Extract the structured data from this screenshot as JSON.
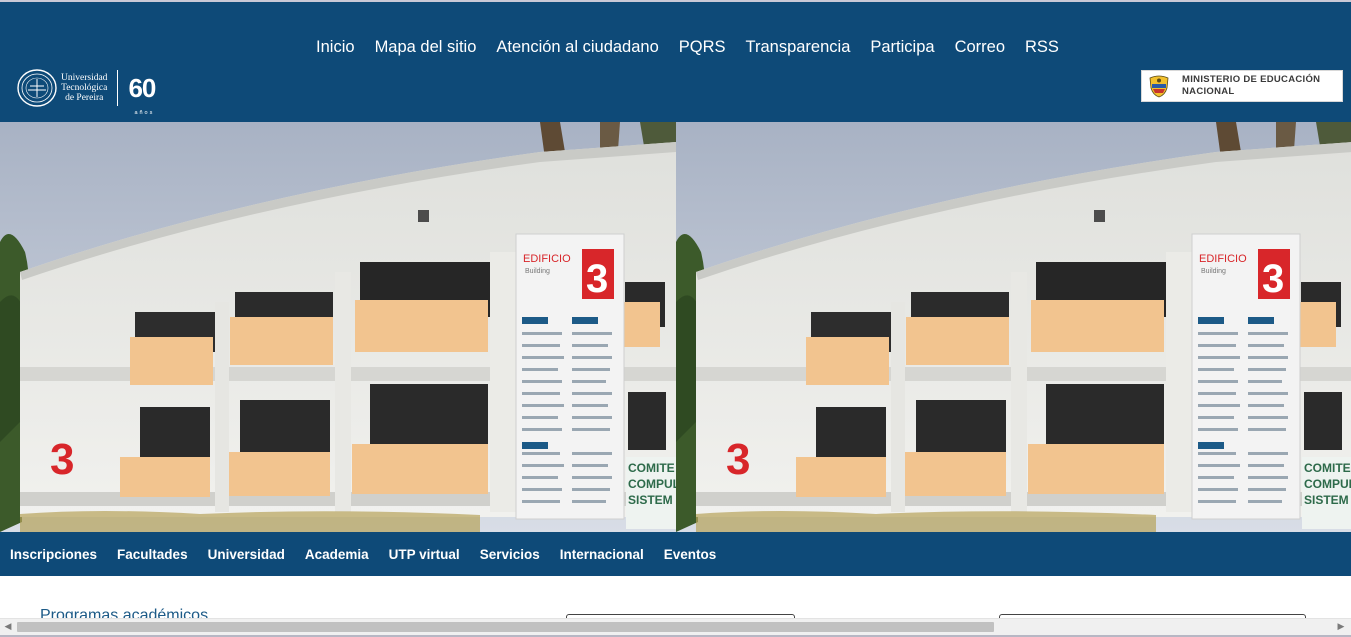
{
  "header": {
    "nav": [
      "Inicio",
      "Mapa del sitio",
      "Atención al ciudadano",
      "PQRS",
      "Transparencia",
      "Participa",
      "Correo",
      "RSS"
    ],
    "logo": {
      "line1": "Universidad",
      "line2": "Tecnológica",
      "line3": "de Pereira",
      "anniversary": "60",
      "anniversary_sub": "años"
    },
    "ministry": {
      "line1": "MINISTERIO DE EDUCACIÓN",
      "line2": "NACIONAL"
    }
  },
  "hero": {
    "sign_title": "EDIFICIO",
    "sign_subtitle": "Building",
    "sign_number": "3",
    "banner_text": "COMITE COMPULS SISTEM"
  },
  "subnav": [
    "Inscripciones",
    "Facultades",
    "Universidad",
    "Academia",
    "UTP virtual",
    "Servicios",
    "Internacional",
    "Eventos"
  ],
  "content": {
    "programas_title": "Programas académicos"
  },
  "colors": {
    "brand_blue": "#0e4a78",
    "white": "#ffffff"
  },
  "icons": [
    "university-seal-icon",
    "colombia-coat-of-arms-icon",
    "scroll-left-icon",
    "scroll-right-icon"
  ]
}
